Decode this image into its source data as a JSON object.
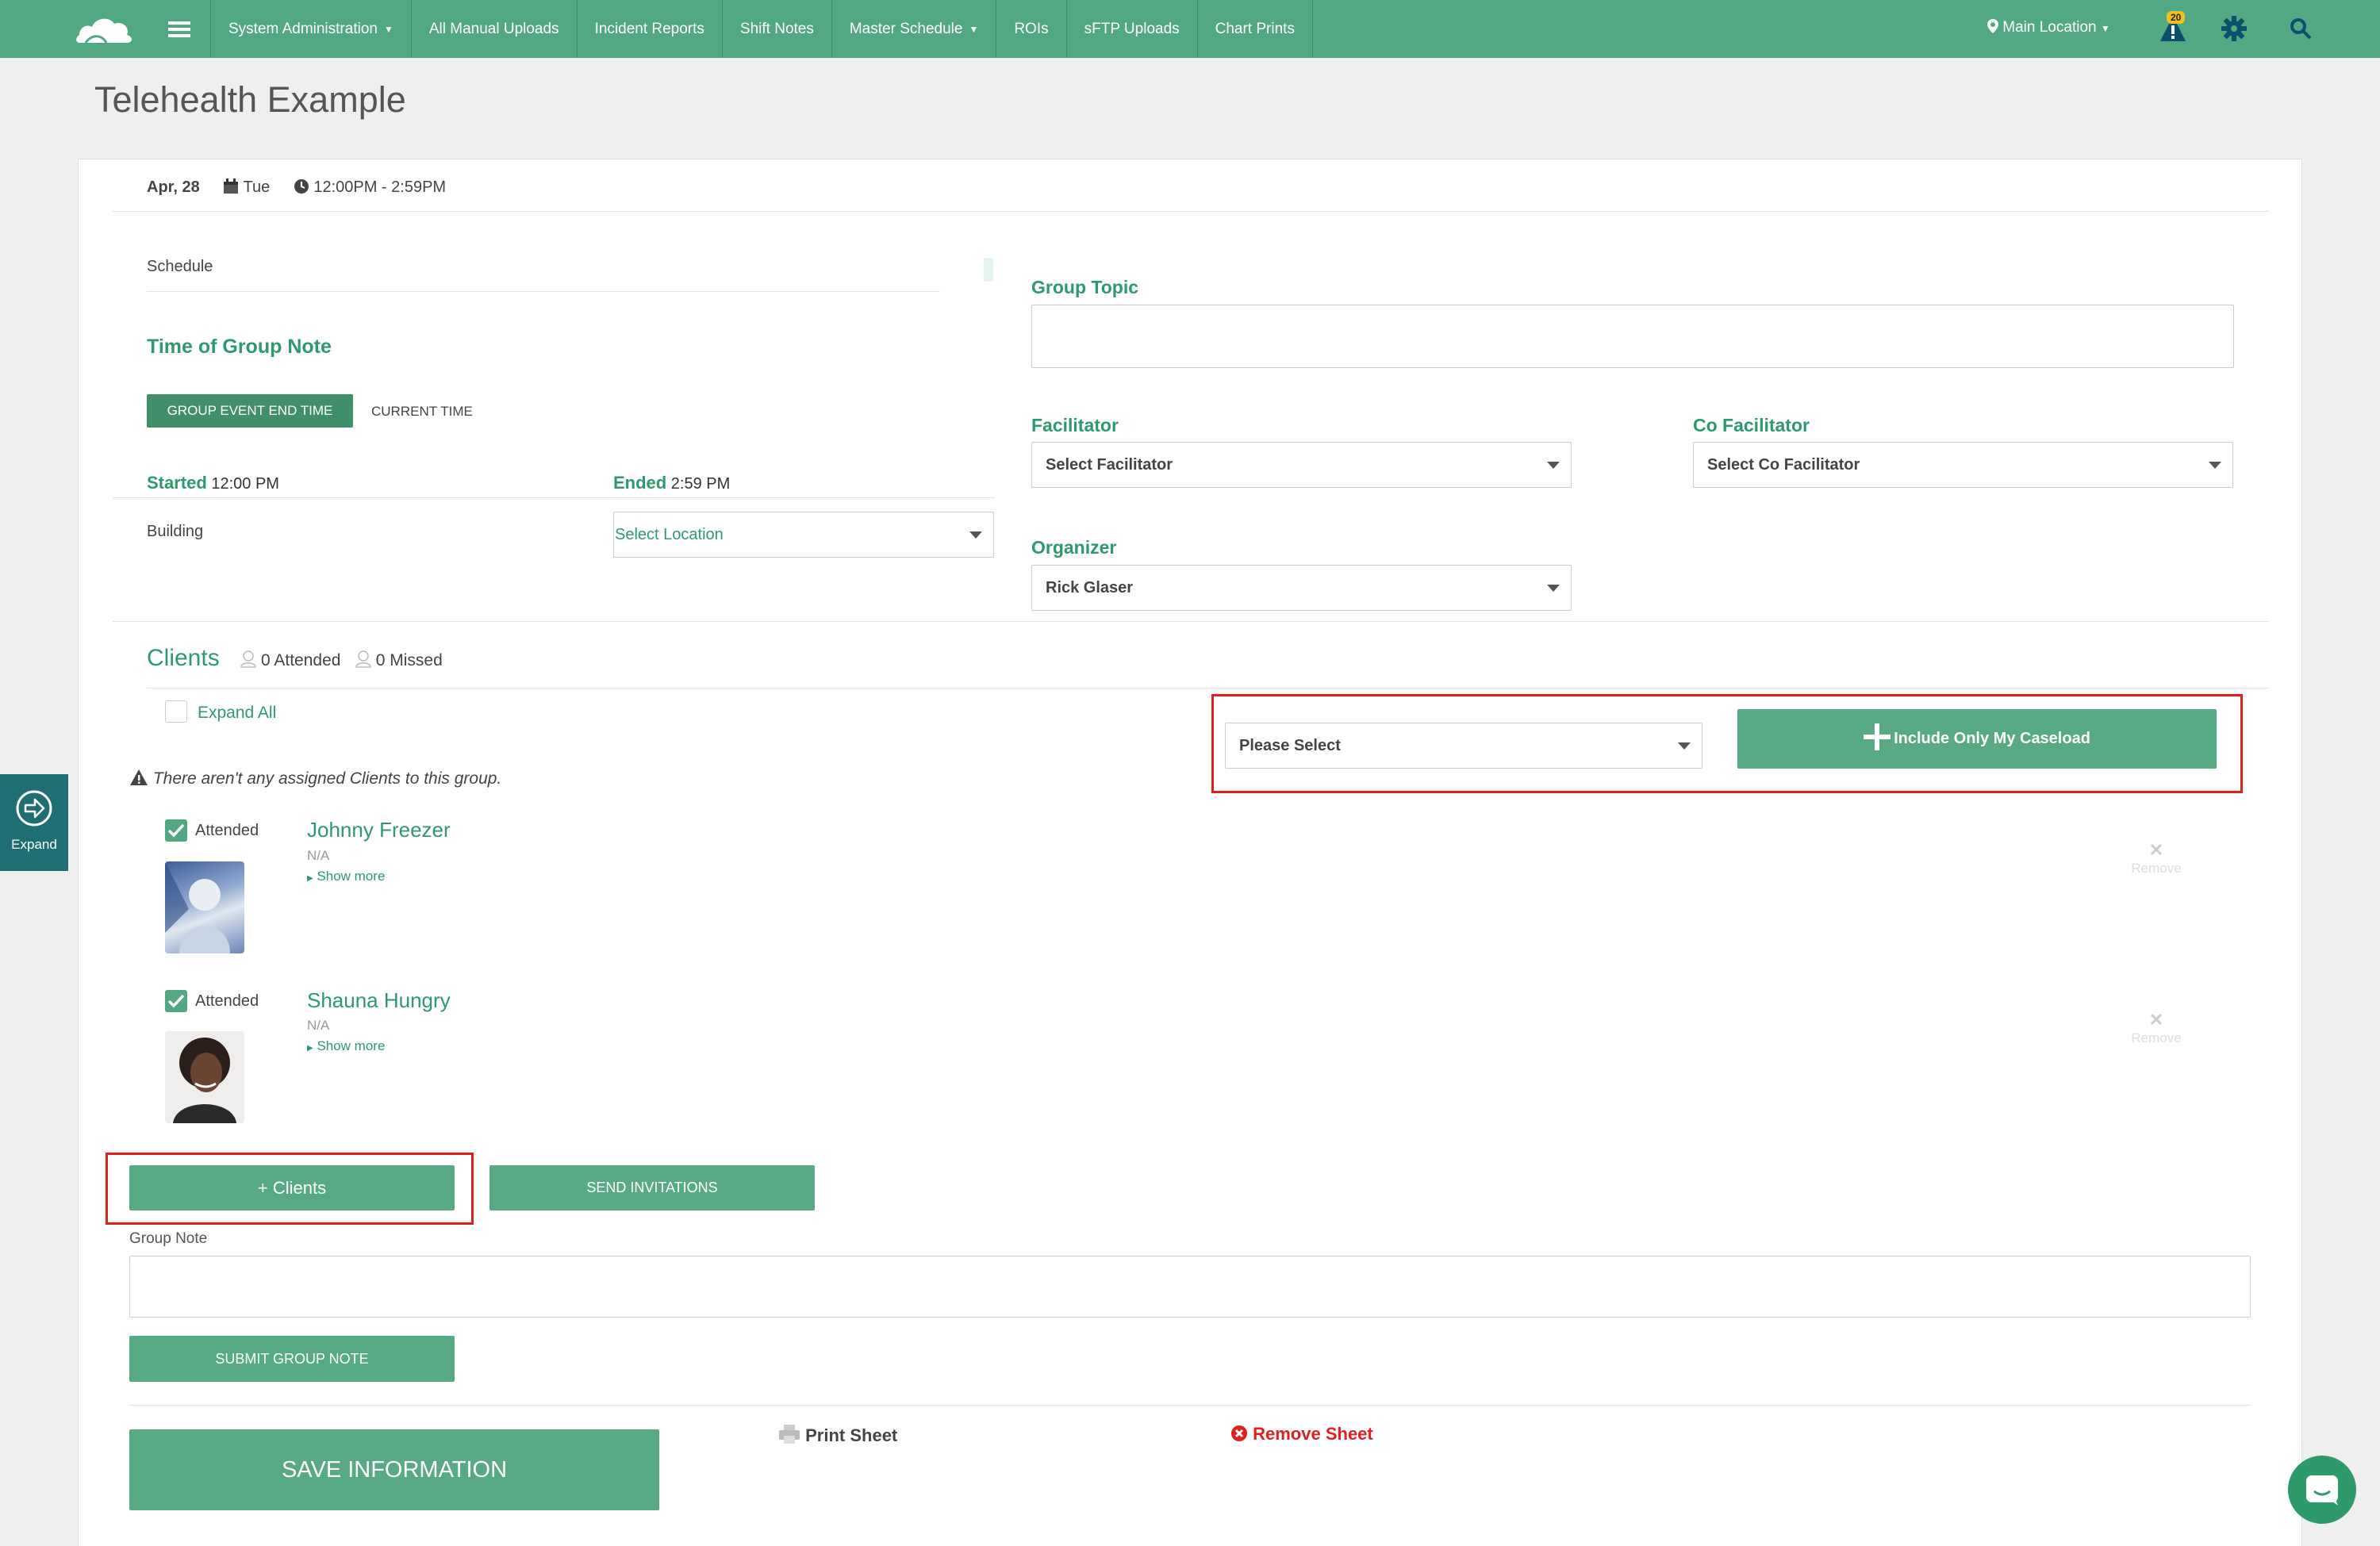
{
  "nav": {
    "items": [
      {
        "label": "System Administration",
        "caret": true
      },
      {
        "label": "All Manual Uploads",
        "caret": false
      },
      {
        "label": "Incident Reports",
        "caret": false
      },
      {
        "label": "Shift Notes",
        "caret": false
      },
      {
        "label": "Master Schedule",
        "caret": true
      },
      {
        "label": "ROIs",
        "caret": false
      },
      {
        "label": "sFTP Uploads",
        "caret": false
      },
      {
        "label": "Chart Prints",
        "caret": false
      }
    ],
    "location": "Main Location",
    "alert_count": "20"
  },
  "page_title": "Telehealth Example",
  "event": {
    "date": "Apr, 28",
    "day": "Tue",
    "time": "12:00PM - 2:59PM"
  },
  "schedule_label": "Schedule",
  "time_of_note": {
    "title": "Time of Group Note",
    "btn_end": "GROUP EVENT END TIME",
    "btn_current": "CURRENT TIME"
  },
  "started": {
    "label": "Started",
    "value": "12:00 PM"
  },
  "ended": {
    "label": "Ended",
    "value": "2:59 PM"
  },
  "building": {
    "label": "Building",
    "select": "Select Location"
  },
  "group_topic": {
    "label": "Group Topic",
    "value": ""
  },
  "facilitator": {
    "label": "Facilitator",
    "select": "Select Facilitator"
  },
  "co_facilitator": {
    "label": "Co Facilitator",
    "select": "Select Co Facilitator"
  },
  "organizer": {
    "label": "Organizer",
    "select": "Rick Glaser"
  },
  "clients": {
    "title": "Clients",
    "attended": "0 Attended",
    "missed": "0 Missed",
    "expand_all": "Expand All",
    "warning": "There aren't any assigned Clients to this group.",
    "select": "Please Select",
    "caseload_btn": "Include Only My Caseload",
    "list": [
      {
        "status": "Attended",
        "name": "Johnny Freezer",
        "sub": "N/A",
        "more": "Show more",
        "remove": "Remove"
      },
      {
        "status": "Attended",
        "name": "Shauna Hungry",
        "sub": "N/A",
        "more": "Show more",
        "remove": "Remove"
      }
    ],
    "add_btn": "+ Clients",
    "invite_btn": "SEND INVITATIONS"
  },
  "group_note": {
    "label": "Group Note",
    "value": "",
    "submit": "SUBMIT GROUP NOTE"
  },
  "footer": {
    "save": "SAVE INFORMATION",
    "print": "Print Sheet",
    "remove": "Remove Sheet"
  },
  "expand_tab": "Expand",
  "colors": {
    "brand": "#52a882",
    "accent_text": "#2e9a6c",
    "highlight": "#e02020",
    "side_tab": "#1e6e73"
  }
}
